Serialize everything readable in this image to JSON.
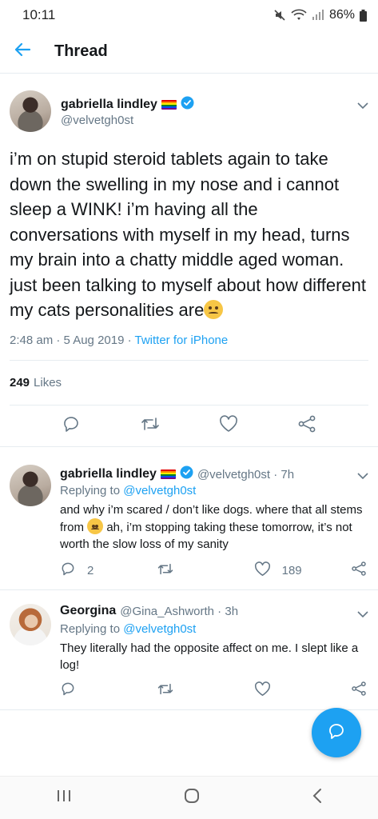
{
  "status_bar": {
    "time": "10:11",
    "battery": "86%"
  },
  "header": {
    "title": "Thread"
  },
  "main_tweet": {
    "name": "gabriella lindley",
    "handle": "@velvetgh0st",
    "text": "i’m on stupid steroid tablets again to take down the swelling in my nose and i cannot sleep a WINK! i’m having all the conversations with myself in my head, turns my brain into a chatty middle aged woman. just been talking to myself about how different my cats personalities are",
    "timestamp": "2:48 am · 5 Aug 2019 · ",
    "source": "Twitter for iPhone",
    "likes_count": "249",
    "likes_label": "Likes"
  },
  "replies": [
    {
      "name": "gabriella lindley",
      "handle_time": "@velvetgh0st · 7h",
      "replying_label": "Replying to ",
      "replying_to": "@velvetgh0st",
      "text_before": "and why i’m scared / don’t like dogs. where that all stems from ",
      "text_after": " ah, i’m stopping taking these tomorrow, it’s not worth the slow loss of my sanity",
      "reply_count": "2",
      "like_count": "189"
    },
    {
      "name": "Georgina",
      "handle_time": "@Gina_Ashworth · 3h",
      "replying_label": "Replying to ",
      "replying_to": "@velvetgh0st",
      "text": "They literally had the opposite affect on me. I slept like a log!"
    }
  ],
  "colors": {
    "accent": "#1da1f2",
    "secondary_text": "#657786",
    "divider": "#e6ecf0"
  },
  "icons": [
    "back-arrow-icon",
    "verified-badge-icon",
    "chevron-down-icon",
    "reply-icon",
    "retweet-icon",
    "like-icon",
    "share-icon",
    "compose-reply-icon",
    "recents-icon",
    "home-icon",
    "back-icon"
  ]
}
